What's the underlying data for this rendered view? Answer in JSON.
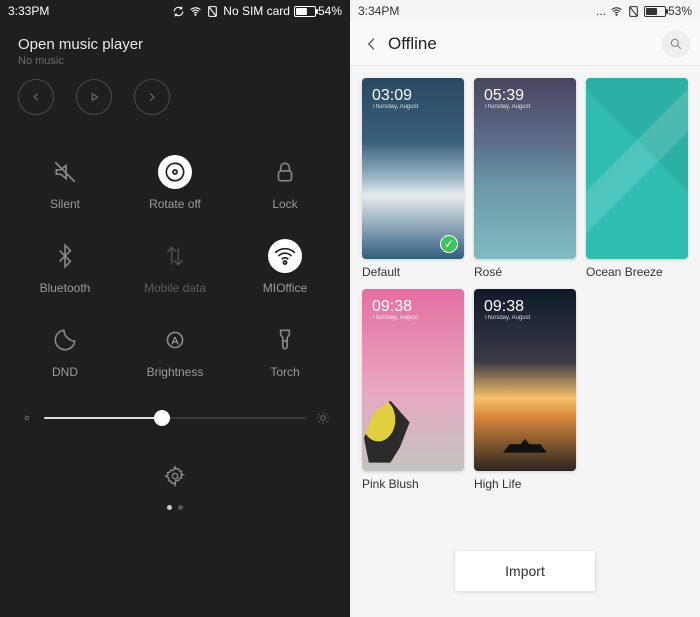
{
  "left": {
    "status": {
      "time": "3:33PM",
      "sim": "No SIM card",
      "battery_pct": "54%",
      "battery_level": 54
    },
    "music": {
      "title": "Open music player",
      "subtitle": "No music"
    },
    "toggles": [
      {
        "name": "silent",
        "label": "Silent",
        "active": false,
        "dim": false
      },
      {
        "name": "rotate",
        "label": "Rotate off",
        "active": true,
        "dim": false
      },
      {
        "name": "lock",
        "label": "Lock",
        "active": false,
        "dim": false
      },
      {
        "name": "bluetooth",
        "label": "Bluetooth",
        "active": false,
        "dim": false
      },
      {
        "name": "mobiledata",
        "label": "Mobile data",
        "active": false,
        "dim": true
      },
      {
        "name": "wifi",
        "label": "MIOffice",
        "active": true,
        "dim": false
      },
      {
        "name": "dnd",
        "label": "DND",
        "active": false,
        "dim": false
      },
      {
        "name": "brightness",
        "label": "Brightness",
        "active": false,
        "dim": false
      },
      {
        "name": "torch",
        "label": "Torch",
        "active": false,
        "dim": false
      }
    ],
    "brightness_slider": {
      "value": 45
    }
  },
  "right": {
    "status": {
      "time": "3:34PM",
      "battery_pct": "53%",
      "battery_level": 53
    },
    "title": "Offline",
    "themes": [
      {
        "name": "Default",
        "clock": "03:09",
        "selected": true,
        "skin": "t-default"
      },
      {
        "name": "Rosé",
        "clock": "05:39",
        "selected": false,
        "skin": "t-rose"
      },
      {
        "name": "Ocean Breeze",
        "clock": "",
        "selected": false,
        "skin": "t-ocean"
      },
      {
        "name": "Pink Blush",
        "clock": "09:38",
        "selected": false,
        "skin": "t-pink"
      },
      {
        "name": "High Life",
        "clock": "09:38",
        "selected": false,
        "skin": "t-high"
      }
    ],
    "import_label": "Import"
  }
}
